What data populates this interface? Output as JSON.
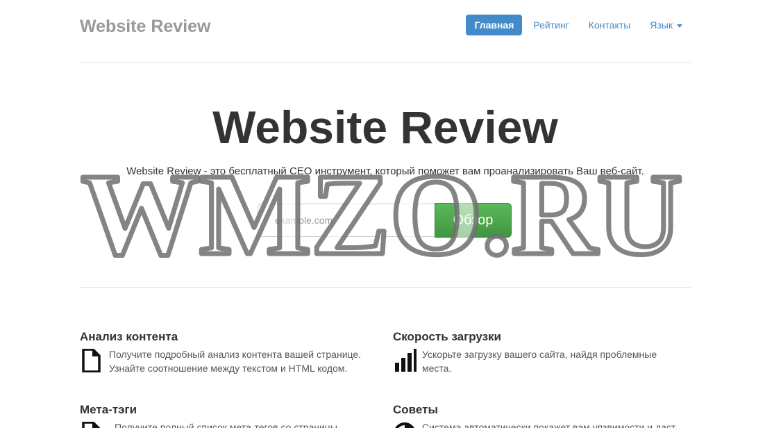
{
  "header": {
    "brand": "Website Review",
    "nav": [
      {
        "label": "Главная",
        "active": true
      },
      {
        "label": "Рейтинг",
        "active": false
      },
      {
        "label": "Контакты",
        "active": false
      },
      {
        "label": "Язык",
        "active": false,
        "dropdown": true
      }
    ]
  },
  "jumbotron": {
    "title": "Website Review",
    "lead": "Website Review - это бесплатный СЕО инструмент, который поможет вам проанализировать Ваш веб-сайт.",
    "search": {
      "placeholder": "example.com",
      "button_label": "Обзор"
    }
  },
  "watermark": {
    "text": "WMZO.RU"
  },
  "features": [
    {
      "title": "Анализ контента",
      "icon": "document-icon",
      "text": "Получите подробный анализ контента вашей странице. Узнайте соотношение между текстом и HTML кодом."
    },
    {
      "title": "Скорость загрузки",
      "icon": "bar-chart-icon",
      "text": "Ускорьте загрузку вашего сайта, найдя проблемные места."
    },
    {
      "title": "Мета-тэги",
      "icon": "document-icon",
      "text": "Получите полный список мета-тегов со страницы"
    },
    {
      "title": "Советы",
      "icon": "tips-icon",
      "text": "Система автоматически покажет вам уязвимости и даст"
    }
  ],
  "colors": {
    "primary": "#428bca",
    "success": "#5cb85c",
    "brand_gray": "#999999",
    "text": "#333333"
  }
}
